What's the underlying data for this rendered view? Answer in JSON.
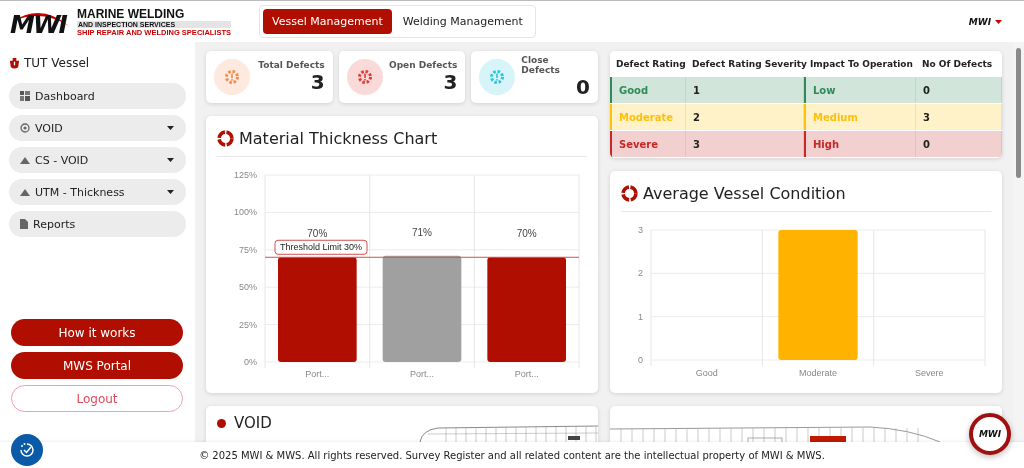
{
  "header": {
    "logo": {
      "mark": "MWI",
      "name": "MARINE WELDING",
      "subtitle": "AND INSPECTION SERVICES",
      "tagline": "SHIP REPAIR AND WELDING SPECIALISTS"
    },
    "tabs": [
      {
        "label": "Vessel Management",
        "selected": true
      },
      {
        "label": "Welding Management",
        "selected": false
      }
    ],
    "account": {
      "mark": "MWI"
    }
  },
  "sidebar": {
    "vessel": "TUT Vessel",
    "items": [
      {
        "label": "Dashboard",
        "kind": "link"
      },
      {
        "label": "VOID",
        "kind": "dropdown"
      },
      {
        "label": "CS - VOID",
        "kind": "dropdown"
      },
      {
        "label": "UTM - Thickness",
        "kind": "dropdown"
      },
      {
        "label": "Reports",
        "kind": "link"
      }
    ],
    "buttons": [
      {
        "label": "How it works",
        "kind": "primary"
      },
      {
        "label": "MWS Portal",
        "kind": "primary"
      },
      {
        "label": "Logout",
        "kind": "outline"
      }
    ]
  },
  "stats": [
    {
      "label": "Total Defects",
      "value": "3",
      "color": "#f28c4f"
    },
    {
      "label": "Open Defects",
      "value": "3",
      "color": "#e53935"
    },
    {
      "label": "Close Defects",
      "value": "0",
      "color": "#29c5e0"
    }
  ],
  "defect_table": {
    "columns": [
      "Defect Rating",
      "Defect Rating Severity",
      "Impact To Operation",
      "No Of Defects"
    ],
    "rows": [
      {
        "rating": "Good",
        "severity": "1",
        "impact": "Low",
        "count": "0",
        "color": "#2e8b57"
      },
      {
        "rating": "Moderate",
        "severity": "2",
        "impact": "Medium",
        "count": "3",
        "color": "#ffc107"
      },
      {
        "rating": "Severe",
        "severity": "3",
        "impact": "High",
        "count": "0",
        "color": "#c62828"
      }
    ]
  },
  "thickness_card": {
    "title": "Material Thickness Chart",
    "chart_data": {
      "type": "bar",
      "categories": [
        "Port...",
        "Port...",
        "Port..."
      ],
      "series": [
        {
          "color": "#b00e00",
          "colors": [
            null,
            "#a0a0a0",
            null
          ],
          "values": [
            70,
            71,
            70
          ]
        }
      ],
      "grid": true,
      "value_labels": [
        "70%",
        "71%",
        "70%"
      ],
      "ylim": [
        0,
        125
      ],
      "yticks": [
        {
          "value": 0,
          "label": "0%"
        },
        {
          "value": 25,
          "label": "25%"
        },
        {
          "value": 50,
          "label": "50%"
        },
        {
          "value": 75,
          "label": "75%"
        },
        {
          "value": 100,
          "label": "100%"
        },
        {
          "value": 125,
          "label": "125%"
        }
      ],
      "ref_lines": [
        {
          "axis": "y",
          "value": 70,
          "label": "Threshold Limit 30%"
        }
      ]
    }
  },
  "condition_card": {
    "title": "Average Vessel Condition",
    "chart_data": {
      "type": "bar",
      "categories": [
        "Good",
        "Moderate",
        "Severe"
      ],
      "series": [
        {
          "color": "#ffb300",
          "values": [
            0,
            3,
            0
          ]
        }
      ],
      "grid": true,
      "ylim": [
        0,
        3
      ],
      "yticks": [
        0,
        1,
        2,
        3
      ]
    }
  },
  "void_card": {
    "title": "VOID"
  },
  "floating": {
    "mark": "MWI"
  },
  "footer": "© 2025 MWI & MWS. All rights reserved. Survey Register and all related content are the intellectual property of MWI & MWS."
}
